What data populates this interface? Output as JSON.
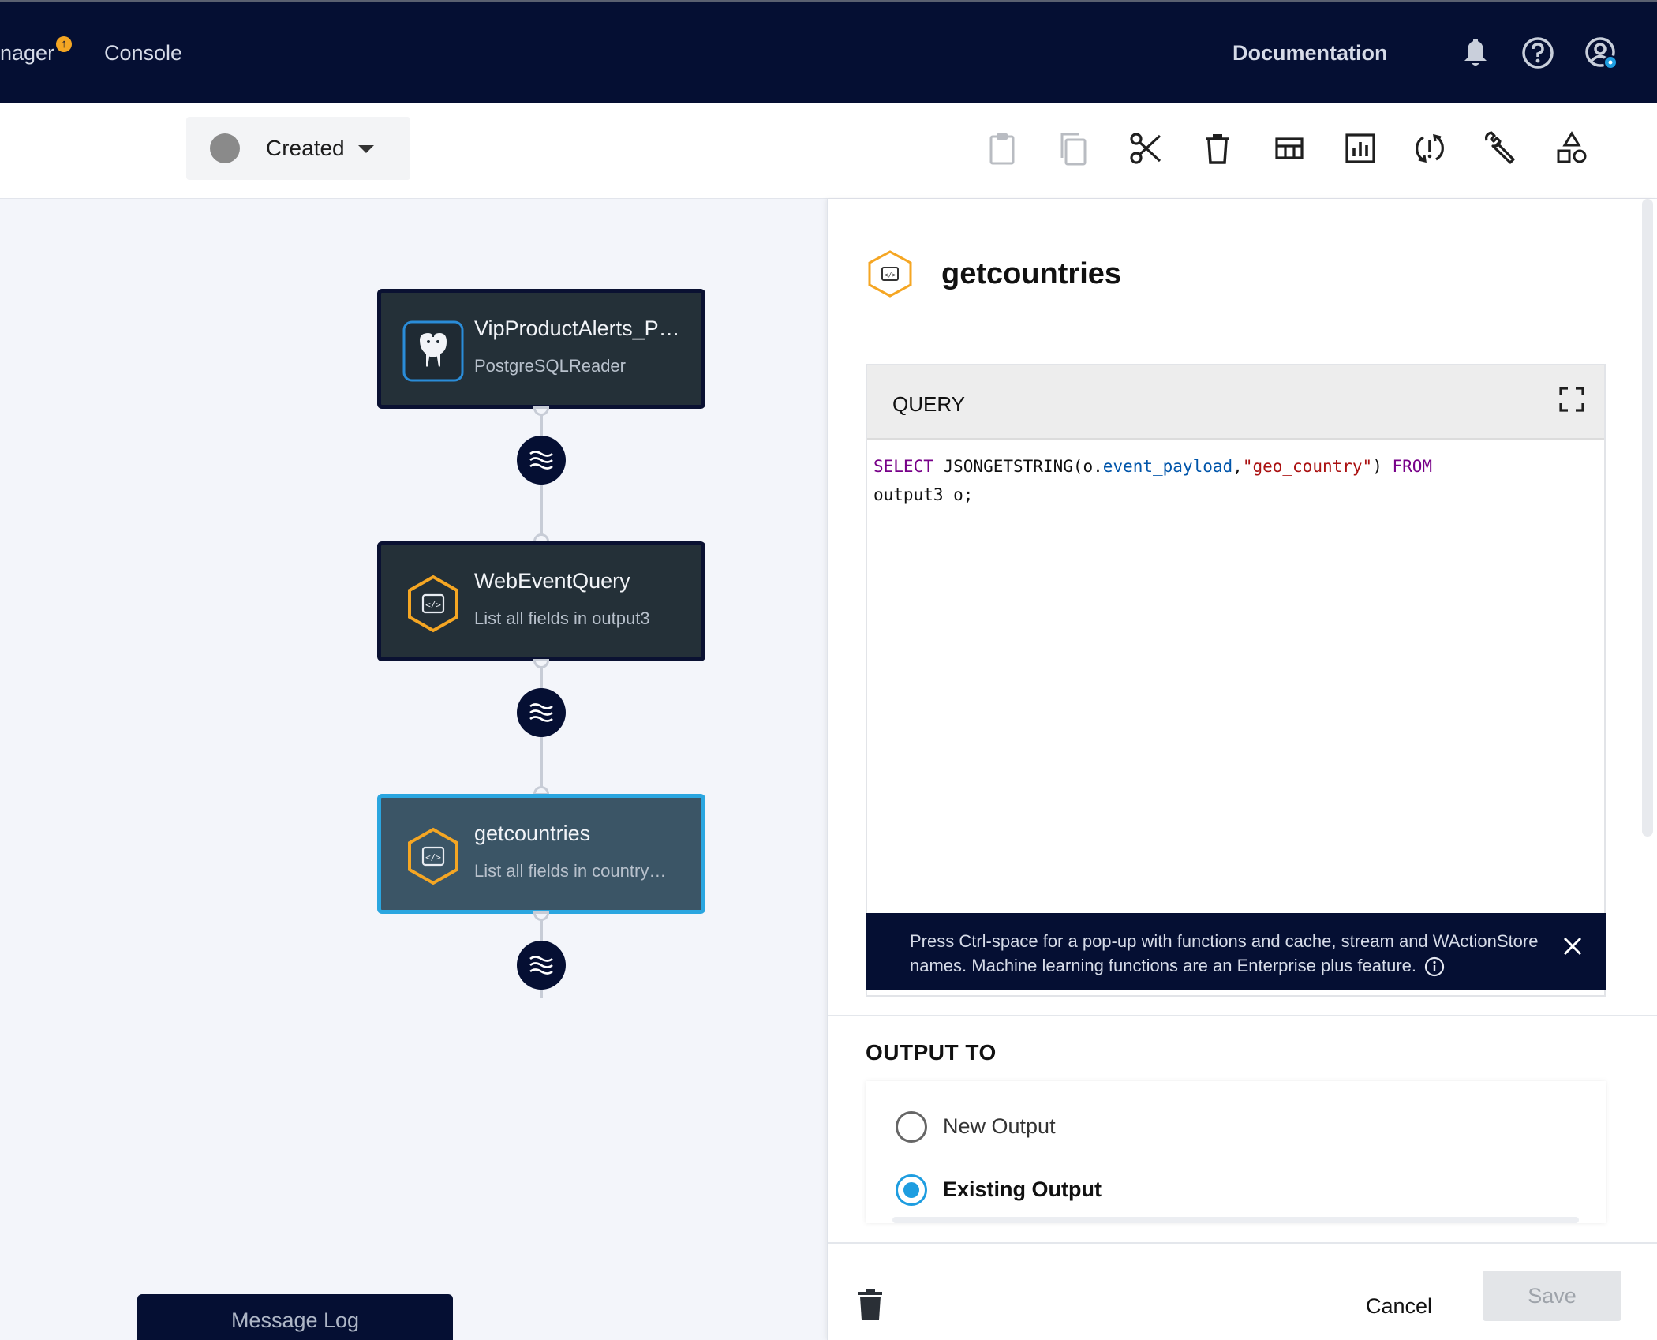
{
  "topnav": {
    "manager_label": "nager",
    "manager_badge": "↑",
    "console_label": "Console",
    "docs_label": "Documentation",
    "icons": [
      "bell-icon",
      "help-icon",
      "user-settings-icon"
    ]
  },
  "toolbar": {
    "status_label": "Created",
    "status_color": "#8a8a8a",
    "icons": [
      "paste-icon",
      "copy-icon",
      "cut-icon",
      "delete-icon",
      "layout-icon",
      "chart-icon",
      "refresh-alert-icon",
      "wrench-icon",
      "shapes-icon"
    ]
  },
  "canvas": {
    "nodes": [
      {
        "title": "VipProductAlerts_P…",
        "subtitle": "PostgreSQLReader",
        "icon": "postgresql-icon"
      },
      {
        "title": "WebEventQuery",
        "subtitle": "List all fields in output3",
        "icon": "query-icon"
      },
      {
        "title": "getcountries",
        "subtitle": "List all fields in country…",
        "icon": "query-icon",
        "selected": true
      }
    ],
    "stream_icon": "stream-icon",
    "message_log_label": "Message Log"
  },
  "panel": {
    "title": "getcountries",
    "query_label": "QUERY",
    "code": {
      "kw_select": "SELECT",
      "fn": " JSONGETSTRING(o.",
      "prop": "event_payload",
      "comma": ",",
      "str": "\"geo_country\"",
      "close": ") ",
      "kw_from": "FROM",
      "line2": "output3 o;"
    },
    "hint_text": "Press Ctrl-space for a pop-up with functions and cache, stream and WActionStore names. Machine learning functions are an Enterprise plus feature.",
    "output_to_label": "OUTPUT TO",
    "options": [
      {
        "label": "New Output",
        "selected": false
      },
      {
        "label": "Existing Output",
        "selected": true
      }
    ],
    "cancel_label": "Cancel",
    "save_label": "Save"
  },
  "colors": {
    "nav_bg": "#050f33",
    "accent_blue": "#1e9de0",
    "hex_orange": "#f5a623"
  }
}
